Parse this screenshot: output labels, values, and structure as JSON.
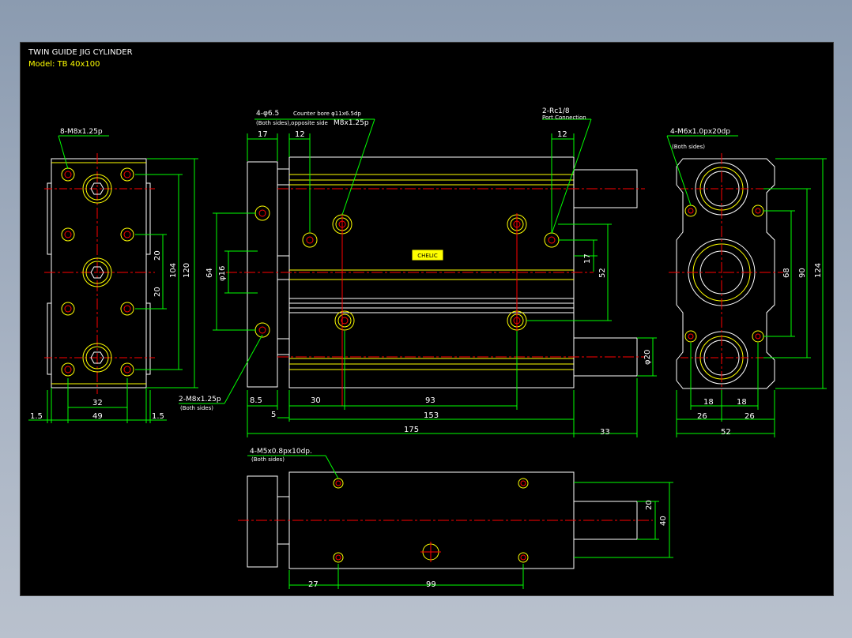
{
  "title": {
    "line1": "TWIN GUIDE JIG CYLINDER",
    "line2": "Model: TB 40x100"
  },
  "colors": {
    "background": "#000000",
    "outline": "#ffffff",
    "hidden": "#ffff00",
    "center": "#ff0000",
    "dimension": "#00ff00",
    "text": "#ffffff",
    "title_model": "#ffff00"
  },
  "annotations": {
    "left_holes": "8-M8x1.25p",
    "front_counterbore_a": "4-φ6.5",
    "front_counterbore_b": "Counter bore φ11x6.5dp",
    "front_both_sides": "(Both sides),opposite side",
    "front_thread": "M8x1.25p",
    "port_count": "2-Rc1/8",
    "port_label": "Port Connection",
    "rear_holes": "4-M6x1.0px20dp",
    "rear_both_sides": "(Both sides)",
    "mount_holes": "2-M8x1.25p",
    "mount_both_sides": "(Both sides)",
    "bottom_holes": "4-M5x0.8px10dp.",
    "bottom_both_sides": "(Both sides)",
    "logo_text": "CHELIC"
  },
  "dimensions": {
    "left": {
      "d120": "120",
      "d104": "104",
      "d20a": "20",
      "d20b": "20",
      "d32": "32",
      "d49": "49",
      "d15a": "1.5",
      "d15b": "1.5"
    },
    "front": {
      "d17": "17",
      "d12a": "12",
      "d12b": "12",
      "d64": "64",
      "d16": "φ16",
      "d17b": "17",
      "d52": "52",
      "d20": "φ20",
      "d85": "8.5",
      "d5": "5",
      "d30": "30",
      "d93": "93",
      "d153": "153",
      "d175": "175",
      "d33": "33"
    },
    "right": {
      "d124": "124",
      "d90": "90",
      "d68": "68",
      "d18a": "18",
      "d18b": "18",
      "d26a": "26",
      "d26b": "26",
      "d52": "52"
    },
    "bottom": {
      "d20": "20",
      "d40": "40",
      "d27": "27",
      "d99": "99"
    }
  }
}
